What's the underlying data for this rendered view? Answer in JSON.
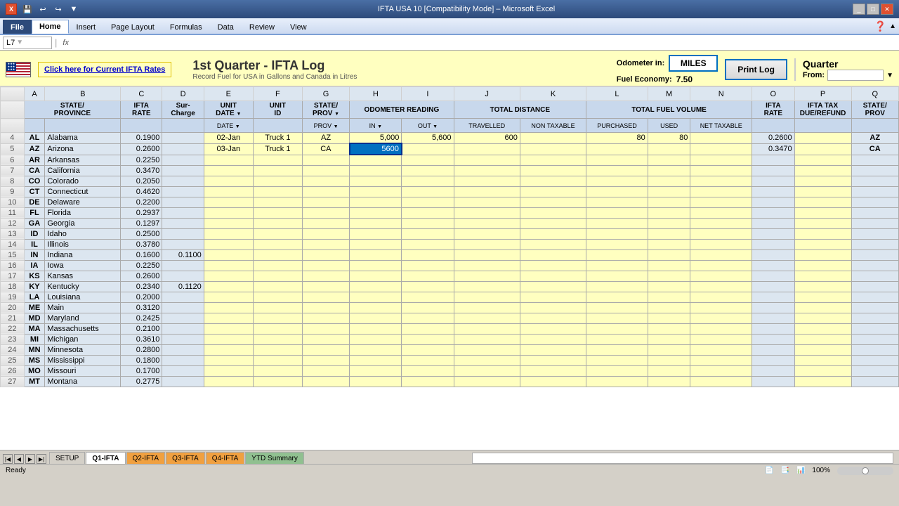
{
  "titleBar": {
    "title": "IFTA USA 10  [Compatibility Mode] – Microsoft Excel",
    "winIcon": "X",
    "buttons": [
      "_",
      "□",
      "✕"
    ]
  },
  "qat": {
    "buttons": [
      "💾",
      "↩",
      "↪",
      "📋",
      "📄",
      "🖨",
      "🔍"
    ]
  },
  "ribbon": {
    "tabs": [
      "File",
      "Home",
      "Insert",
      "Page Layout",
      "Formulas",
      "Data",
      "Review",
      "View"
    ],
    "activeTab": "Home"
  },
  "formulaBar": {
    "cellRef": "L7",
    "formula": ""
  },
  "header": {
    "linkText": "Click here for Current IFTA Rates",
    "title": "1st Quarter - IFTA Log",
    "subtitle": "Record Fuel for USA in Gallons and Canada in Litres",
    "odometerLabel": "Odometer in:",
    "odometerValue": "MILES",
    "fuelEconomyLabel": "Fuel Economy:",
    "fuelEconomyValue": "7.50",
    "printBtn": "Print Log",
    "quarterLabel": "Quarter",
    "quarterFromLabel": "From:"
  },
  "columns": {
    "stateProvince": "STATE/\nPROVINCE",
    "iftaRate": "IFTA\nRATE",
    "surCharge": "Sur-\nCharge",
    "unitDate": "DATE",
    "unitID": "UNIT\nID",
    "stateID": "STATE/\nPROV ID",
    "odoIn": "IN",
    "odoOut": "OUT",
    "totalDistance": "TOTAL DISTANCE",
    "travelled": "TOTAL\nTRAVELLED",
    "nonTaxable": "NON TAXABLE",
    "purchased": "TOTAL FUEL VOLUME\nPURCHASED",
    "used": "USED",
    "netTaxable": "NET TAXABLE",
    "iftaRate2": "IFTA\nRATE",
    "iftaTaxDue": "IFTA TAX\nDUE/REFUND",
    "stateProv2": "STATE/\nPROV"
  },
  "states": [
    {
      "code": "AL",
      "name": "Alabama",
      "rate": "0.1900",
      "surcharge": ""
    },
    {
      "code": "AZ",
      "name": "Arizona",
      "rate": "0.2600",
      "surcharge": ""
    },
    {
      "code": "AR",
      "name": "Arkansas",
      "rate": "0.2250",
      "surcharge": ""
    },
    {
      "code": "CA",
      "name": "California",
      "rate": "0.3470",
      "surcharge": ""
    },
    {
      "code": "CO",
      "name": "Colorado",
      "rate": "0.2050",
      "surcharge": ""
    },
    {
      "code": "CT",
      "name": "Connecticut",
      "rate": "0.4620",
      "surcharge": ""
    },
    {
      "code": "DE",
      "name": "Delaware",
      "rate": "0.2200",
      "surcharge": ""
    },
    {
      "code": "FL",
      "name": "Florida",
      "rate": "0.2937",
      "surcharge": ""
    },
    {
      "code": "GA",
      "name": "Georgia",
      "rate": "0.1297",
      "surcharge": ""
    },
    {
      "code": "ID",
      "name": "Idaho",
      "rate": "0.2500",
      "surcharge": ""
    },
    {
      "code": "IL",
      "name": "Illinois",
      "rate": "0.3780",
      "surcharge": ""
    },
    {
      "code": "IN",
      "name": "Indiana",
      "rate": "0.1600",
      "surcharge": "0.1100"
    },
    {
      "code": "IA",
      "name": "Iowa",
      "rate": "0.2250",
      "surcharge": ""
    },
    {
      "code": "KS",
      "name": "Kansas",
      "rate": "0.2600",
      "surcharge": ""
    },
    {
      "code": "KY",
      "name": "Kentucky",
      "rate": "0.2340",
      "surcharge": "0.1120"
    },
    {
      "code": "LA",
      "name": "Louisiana",
      "rate": "0.2000",
      "surcharge": ""
    },
    {
      "code": "ME",
      "name": "Main",
      "rate": "0.3120",
      "surcharge": ""
    },
    {
      "code": "MD",
      "name": "Maryland",
      "rate": "0.2425",
      "surcharge": ""
    },
    {
      "code": "MA",
      "name": "Massachusetts",
      "rate": "0.2100",
      "surcharge": ""
    },
    {
      "code": "MI",
      "name": "Michigan",
      "rate": "0.3610",
      "surcharge": ""
    },
    {
      "code": "MN",
      "name": "Minnesota",
      "rate": "0.2800",
      "surcharge": ""
    },
    {
      "code": "MS",
      "name": "Mississippi",
      "rate": "0.1800",
      "surcharge": ""
    },
    {
      "code": "MO",
      "name": "Missouri",
      "rate": "0.1700",
      "surcharge": ""
    },
    {
      "code": "MT",
      "name": "Montana",
      "rate": "0.2775",
      "surcharge": ""
    }
  ],
  "logRows": [
    {
      "date": "02-Jan",
      "unitID": "Truck 1",
      "stateID": "AZ",
      "odoIn": "5,000",
      "odoOut": "5,600",
      "travelled": "600",
      "nonTaxable": "",
      "purchased": "80",
      "used": "80",
      "netTaxable": "",
      "iftaRate": "0.2600",
      "iftaTax": "",
      "stateProv": "AZ"
    },
    {
      "date": "03-Jan",
      "unitID": "Truck 1",
      "stateID": "CA",
      "odoIn": "5600",
      "odoOut": "",
      "travelled": "",
      "nonTaxable": "",
      "purchased": "",
      "used": "",
      "netTaxable": "",
      "iftaRate": "0.3470",
      "iftaTax": "",
      "stateProv": "CA"
    }
  ],
  "quarterStates": [
    "AZ",
    "CA"
  ],
  "sheetTabs": [
    {
      "name": "SETUP",
      "type": "normal"
    },
    {
      "name": "Q1-IFTA",
      "type": "active"
    },
    {
      "name": "Q2-IFTA",
      "type": "orange"
    },
    {
      "name": "Q3-IFTA",
      "type": "orange"
    },
    {
      "name": "Q4-IFTA",
      "type": "orange"
    },
    {
      "name": "YTD Summary",
      "type": "green"
    }
  ],
  "statusBar": {
    "ready": "Ready",
    "scrollLock": "",
    "zoom": "100%"
  }
}
